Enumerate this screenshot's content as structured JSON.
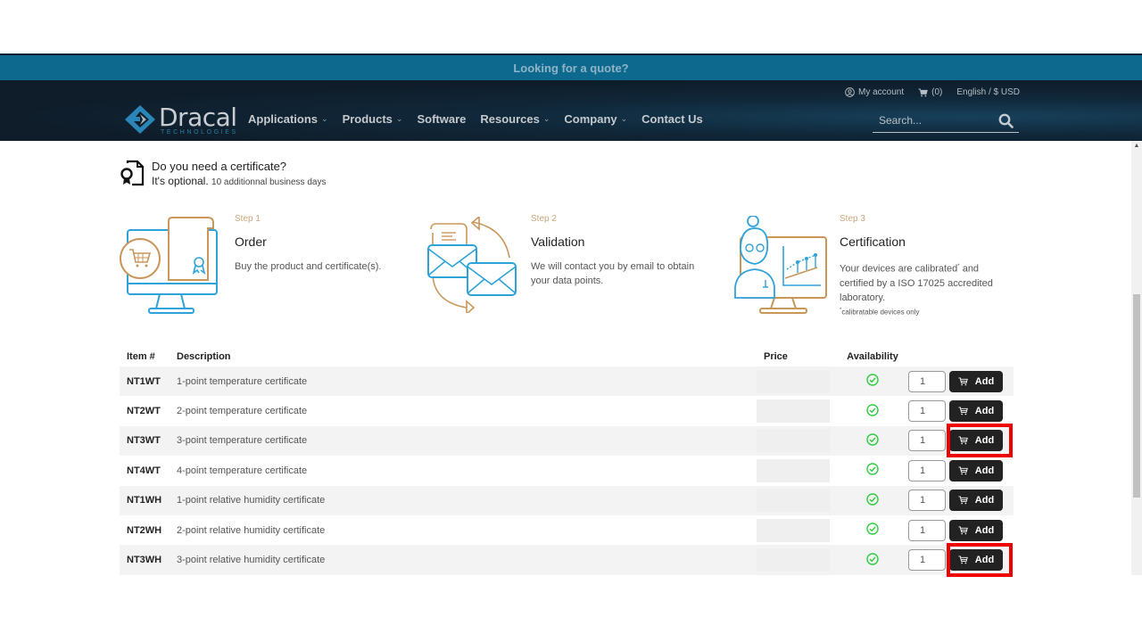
{
  "quote_bar": {
    "label": "Looking for a quote?"
  },
  "header": {
    "logo": {
      "name": "Dracal",
      "tagline": "TECHNOLOGIES"
    },
    "menu": [
      {
        "label": "Applications",
        "has_dropdown": true
      },
      {
        "label": "Products",
        "has_dropdown": true
      },
      {
        "label": "Software",
        "has_dropdown": false
      },
      {
        "label": "Resources",
        "has_dropdown": true
      },
      {
        "label": "Company",
        "has_dropdown": true
      },
      {
        "label": "Contact Us",
        "has_dropdown": false
      }
    ],
    "utility": {
      "account_label": "My account",
      "cart_count": "(0)",
      "locale": "English / $ USD"
    },
    "search": {
      "placeholder": "Search...",
      "value": ""
    }
  },
  "certificate_prompt": {
    "title": "Do you need a certificate?",
    "optional_label": "It's optional.",
    "delay_note": "10 additionnal business days"
  },
  "steps": [
    {
      "label": "Step 1",
      "title": "Order",
      "description": "Buy the product and certificate(s).",
      "icon": "order-computer-cart-certificate-icon"
    },
    {
      "label": "Step 2",
      "title": "Validation",
      "description": "We will contact you by email to obtain your data points.",
      "icon": "email-exchange-icon"
    },
    {
      "label": "Step 3",
      "title": "Certification",
      "description_pre": "Your devices are calibrated",
      "description_post": " and certified by a ISO 17025 accredited laboratory.",
      "footnote": "calibratable devices only",
      "icon": "technician-chart-icon"
    }
  ],
  "table": {
    "columns": [
      "Item #",
      "Description",
      "Price",
      "Availability",
      ""
    ],
    "rows": [
      {
        "code": "NT1WT",
        "description": "1-point temperature certificate",
        "price": "",
        "available": true,
        "qty": "1",
        "button": "Add",
        "highlighted": false
      },
      {
        "code": "NT2WT",
        "description": "2-point temperature certificate",
        "price": "",
        "available": true,
        "qty": "1",
        "button": "Add",
        "highlighted": false
      },
      {
        "code": "NT3WT",
        "description": "3-point temperature certificate",
        "price": "",
        "available": true,
        "qty": "1",
        "button": "Add",
        "highlighted": true
      },
      {
        "code": "NT4WT",
        "description": "4-point temperature certificate",
        "price": "",
        "available": true,
        "qty": "1",
        "button": "Add",
        "highlighted": false
      },
      {
        "code": "NT1WH",
        "description": "1-point relative humidity certificate",
        "price": "",
        "available": true,
        "qty": "1",
        "button": "Add",
        "highlighted": false
      },
      {
        "code": "NT2WH",
        "description": "2-point relative humidity certificate",
        "price": "",
        "available": true,
        "qty": "1",
        "button": "Add",
        "highlighted": false
      },
      {
        "code": "NT3WH",
        "description": "3-point relative humidity certificate",
        "price": "",
        "available": true,
        "qty": "1",
        "button": "Add",
        "highlighted": true
      }
    ]
  },
  "colors": {
    "quote_bar": "#0d6a8e",
    "nav_bg": "#0f1d2a",
    "accent_gold": "#c9a77a",
    "accent_blue": "#2ea3d9",
    "available_green": "#2ecc40",
    "button_dark": "#222222",
    "highlight_red": "#ee0000"
  }
}
